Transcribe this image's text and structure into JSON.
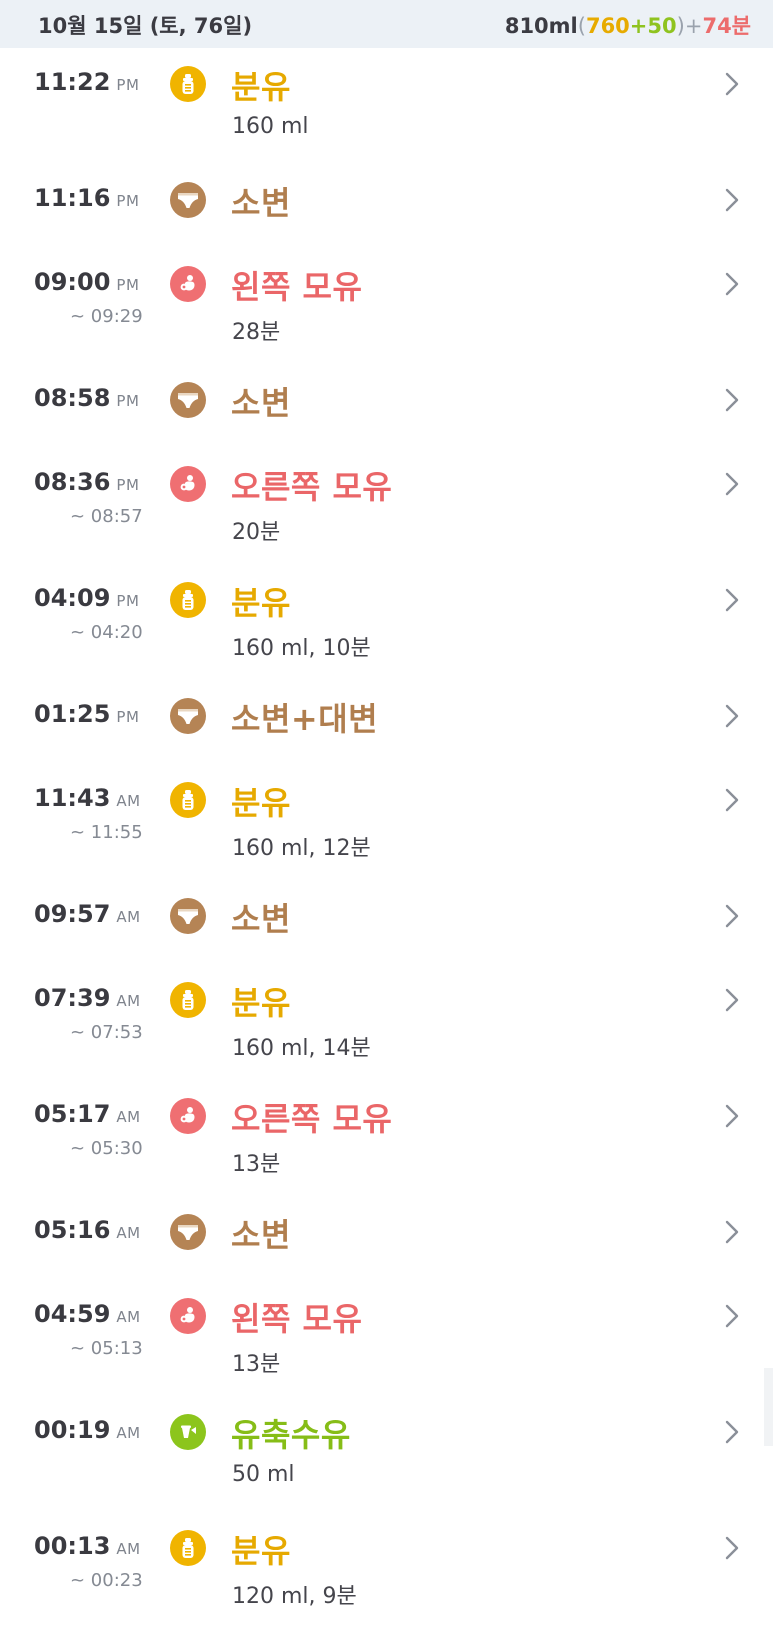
{
  "header": {
    "date": "10월 15일 (토, 76일)",
    "total": "810ml",
    "open_paren": "(",
    "formula_ml": "760",
    "plus1": "+",
    "pumped_ml": "50",
    "close_paren": ")",
    "plus2": "+",
    "breast_time": "74분"
  },
  "colors": {
    "formula": "#e6a900",
    "diaper": "#b07e4e",
    "breast": "#ea6668",
    "pumped": "#86bd17",
    "header_bg": "#ecf1f6"
  },
  "entries": [
    {
      "time": "11:22",
      "ampm": "PM",
      "end": "",
      "type": "formula",
      "icon": "bottle-icon",
      "title": "분유",
      "detail": "160 ml"
    },
    {
      "time": "11:16",
      "ampm": "PM",
      "end": "",
      "type": "diaper",
      "icon": "diaper-icon",
      "title": "소변",
      "detail": ""
    },
    {
      "time": "09:00",
      "ampm": "PM",
      "end": "~ 09:29",
      "type": "breast",
      "icon": "breastfeeding-icon",
      "title": "왼쪽 모유",
      "detail": "28분"
    },
    {
      "time": "08:58",
      "ampm": "PM",
      "end": "",
      "type": "diaper",
      "icon": "diaper-icon",
      "title": "소변",
      "detail": ""
    },
    {
      "time": "08:36",
      "ampm": "PM",
      "end": "~ 08:57",
      "type": "breast",
      "icon": "breastfeeding-icon",
      "title": "오른쪽 모유",
      "detail": "20분"
    },
    {
      "time": "04:09",
      "ampm": "PM",
      "end": "~ 04:20",
      "type": "formula",
      "icon": "bottle-icon",
      "title": "분유",
      "detail": "160 ml, 10분"
    },
    {
      "time": "01:25",
      "ampm": "PM",
      "end": "",
      "type": "diaper",
      "icon": "diaper-icon",
      "title": "소변+대변",
      "detail": ""
    },
    {
      "time": "11:43",
      "ampm": "AM",
      "end": "~ 11:55",
      "type": "formula",
      "icon": "bottle-icon",
      "title": "분유",
      "detail": "160 ml, 12분"
    },
    {
      "time": "09:57",
      "ampm": "AM",
      "end": "",
      "type": "diaper",
      "icon": "diaper-icon",
      "title": "소변",
      "detail": ""
    },
    {
      "time": "07:39",
      "ampm": "AM",
      "end": "~ 07:53",
      "type": "formula",
      "icon": "bottle-icon",
      "title": "분유",
      "detail": "160 ml, 14분"
    },
    {
      "time": "05:17",
      "ampm": "AM",
      "end": "~ 05:30",
      "type": "breast",
      "icon": "breastfeeding-icon",
      "title": "오른쪽 모유",
      "detail": "13분"
    },
    {
      "time": "05:16",
      "ampm": "AM",
      "end": "",
      "type": "diaper",
      "icon": "diaper-icon",
      "title": "소변",
      "detail": ""
    },
    {
      "time": "04:59",
      "ampm": "AM",
      "end": "~ 05:13",
      "type": "breast",
      "icon": "breastfeeding-icon",
      "title": "왼쪽 모유",
      "detail": "13분"
    },
    {
      "time": "00:19",
      "ampm": "AM",
      "end": "",
      "type": "pumped",
      "icon": "pumped-milk-icon",
      "title": "유축수유",
      "detail": "50 ml"
    },
    {
      "time": "00:13",
      "ampm": "AM",
      "end": "~ 00:23",
      "type": "formula",
      "icon": "bottle-icon",
      "title": "분유",
      "detail": "120 ml, 9분"
    }
  ]
}
